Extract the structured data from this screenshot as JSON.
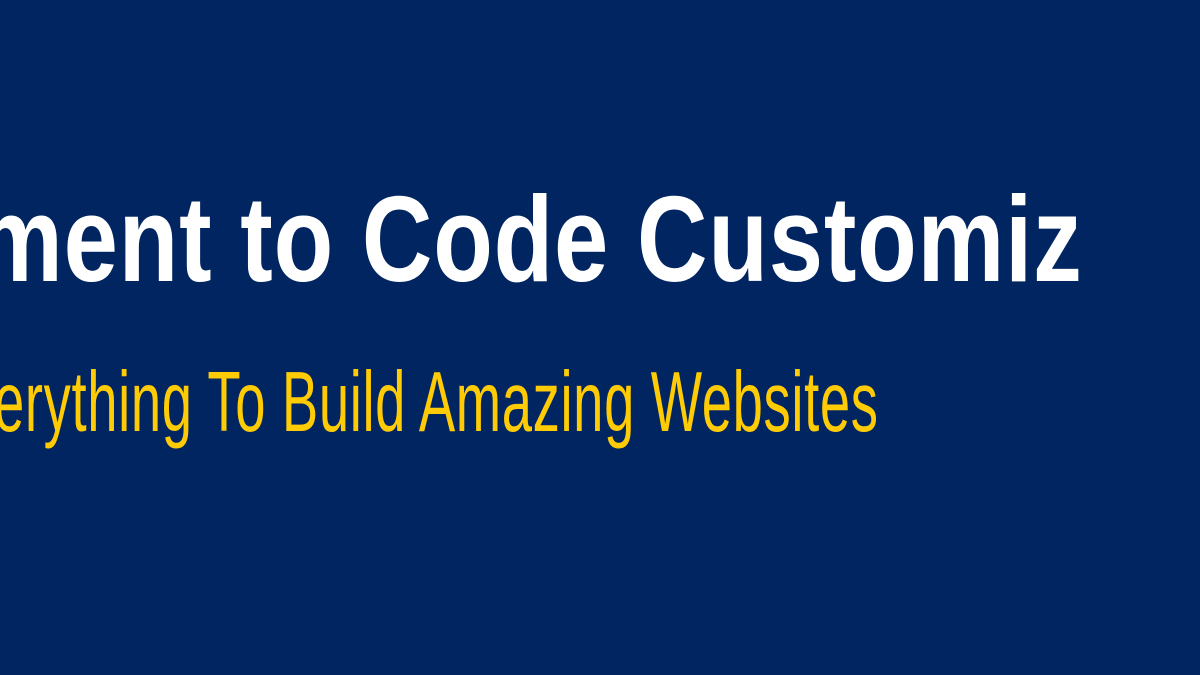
{
  "banner": {
    "headline": "ment to Code Customiz",
    "subline": "erything To Build Amazing Websites"
  },
  "colors": {
    "background": "#012561",
    "headline": "#ffffff",
    "subline": "#ffcb05"
  }
}
